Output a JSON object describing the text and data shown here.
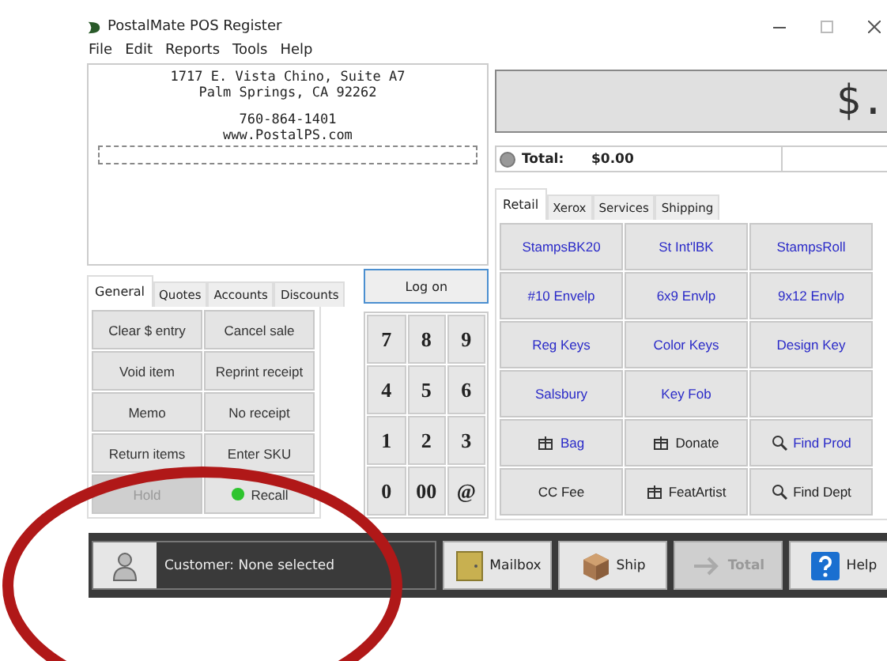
{
  "window": {
    "title": "PostalMate POS Register"
  },
  "menu": [
    "File",
    "Edit",
    "Reports",
    "Tools",
    "Help"
  ],
  "receipt": {
    "address": [
      "1717 E. Vista Chino, Suite A7",
      "Palm Springs, CA 92262"
    ],
    "contact": [
      "760-864-1401",
      "www.PostalPS.com"
    ]
  },
  "display": {
    "text": "$."
  },
  "total": {
    "label": "Total:",
    "value": "$0.00"
  },
  "left_tabs": [
    {
      "label": "General",
      "selected": true
    },
    {
      "label": "Quotes",
      "selected": false
    },
    {
      "label": "Accounts",
      "selected": false
    },
    {
      "label": "Discounts",
      "selected": false
    }
  ],
  "left_buttons": [
    {
      "label": "Clear $ entry",
      "disabled": false
    },
    {
      "label": "Cancel sale",
      "disabled": false
    },
    {
      "label": "Void item",
      "disabled": false
    },
    {
      "label": "Reprint receipt",
      "disabled": false
    },
    {
      "label": "Memo",
      "disabled": false
    },
    {
      "label": "No receipt",
      "disabled": false
    },
    {
      "label": "Return items",
      "disabled": false
    },
    {
      "label": "Enter SKU",
      "disabled": false
    },
    {
      "label": "Hold",
      "disabled": true
    },
    {
      "label": "Recall",
      "disabled": false,
      "kind": "lamp"
    }
  ],
  "logon": {
    "label": "Log on"
  },
  "keypad": [
    "7",
    "8",
    "9",
    "4",
    "5",
    "6",
    "1",
    "2",
    "3",
    "0",
    "00",
    "@"
  ],
  "right_tabs": [
    {
      "label": "Retail",
      "selected": true
    },
    {
      "label": "Xerox",
      "selected": false
    },
    {
      "label": "Services",
      "selected": false
    },
    {
      "label": "Shipping",
      "selected": false
    }
  ],
  "retail_buttons": [
    {
      "label": "StampsBK20",
      "color": "#2a2ac8"
    },
    {
      "label": "St Int'lBK",
      "color": "#2a2ac8"
    },
    {
      "label": "StampsRoll",
      "color": "#2a2ac8"
    },
    {
      "label": "#10 Envelp",
      "color": "#2a2ac8"
    },
    {
      "label": "6x9 Envlp",
      "color": "#2a2ac8"
    },
    {
      "label": "9x12 Envlp",
      "color": "#2a2ac8"
    },
    {
      "label": "Reg Keys",
      "color": "#2a2ac8"
    },
    {
      "label": "Color Keys",
      "color": "#2a2ac8"
    },
    {
      "label": "Design Key",
      "color": "#2a2ac8"
    },
    {
      "label": "Salsbury",
      "color": "#2a2ac8"
    },
    {
      "label": "Key Fob",
      "color": "#2a2ac8"
    },
    {
      "kind": "blank"
    },
    {
      "label": "Bag",
      "color": "#2a2ac8",
      "kind": "gift"
    },
    {
      "label": "Donate",
      "color": "#222222",
      "kind": "gift"
    },
    {
      "label": "Find Prod",
      "color": "#2a2ac8",
      "kind": "search"
    },
    {
      "label": "CC Fee",
      "color": "#222222"
    },
    {
      "label": "FeatArtist",
      "color": "#222222",
      "kind": "gift"
    },
    {
      "label": "Find Dept",
      "color": "#222222",
      "kind": "search"
    }
  ],
  "customer": {
    "text": "Customer: None selected"
  },
  "bottom_buttons": [
    {
      "label": "Mailbox",
      "disabled": false
    },
    {
      "label": "Ship",
      "disabled": false
    },
    {
      "label": "Total",
      "disabled": true
    },
    {
      "label": "Help",
      "disabled": false
    }
  ]
}
